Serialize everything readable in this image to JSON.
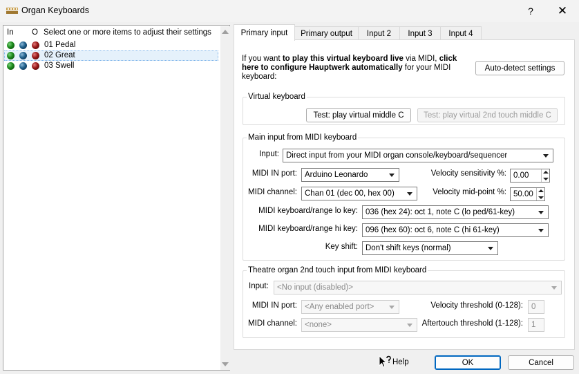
{
  "window": {
    "title": "Organ Keyboards",
    "help_glyph": "?",
    "close_glyph": "✕"
  },
  "list": {
    "headers": {
      "in": "In",
      "o": "O",
      "desc": "Select one or more items to adjust their settings"
    },
    "items": [
      {
        "label": "01 Pedal",
        "selected": false
      },
      {
        "label": "02 Great",
        "selected": true
      },
      {
        "label": "03 Swell",
        "selected": false
      }
    ]
  },
  "tabs": [
    {
      "label": "Primary input",
      "active": true
    },
    {
      "label": "Primary output",
      "active": false
    },
    {
      "label": "Input 2",
      "active": false
    },
    {
      "label": "Input 3",
      "active": false
    },
    {
      "label": "Input 4",
      "active": false
    }
  ],
  "intro": {
    "pre": "If you want ",
    "bold1": "to play this virtual keyboard live",
    "mid": " via MIDI, ",
    "bold2": "click here to configure Hauptwerk automatically",
    "post": " for your MIDI keyboard:"
  },
  "buttons": {
    "auto_detect": "Auto-detect settings",
    "test_middle_c": "Test: play virtual middle C",
    "test_2nd_touch": "Test: play virtual 2nd touch middle C",
    "help": "Help",
    "ok": "OK",
    "cancel": "Cancel"
  },
  "virtual_keyboard": {
    "title": "Virtual keyboard"
  },
  "main_input": {
    "title": "Main input from MIDI keyboard",
    "input_label": "Input:",
    "input_value": "Direct input from your MIDI organ console/keyboard/sequencer",
    "midi_in_port_label": "MIDI IN port:",
    "midi_in_port_value": "Arduino Leonardo",
    "midi_channel_label": "MIDI channel:",
    "midi_channel_value": "Chan 01 (dec 00, hex 00)",
    "velocity_sensitivity_label": "Velocity sensitivity %:",
    "velocity_sensitivity_value": "0.00",
    "velocity_midpoint_label": "Velocity mid-point %:",
    "velocity_midpoint_value": "50.00",
    "lo_key_label": "MIDI keyboard/range lo key:",
    "lo_key_value": "036 (hex 24): oct 1, note C (lo ped/61-key)",
    "hi_key_label": "MIDI keyboard/range hi key:",
    "hi_key_value": "096 (hex 60): oct 6, note C (hi 61-key)",
    "key_shift_label": "Key shift:",
    "key_shift_value": "Don't shift keys (normal)"
  },
  "theatre_input": {
    "title": "Theatre organ 2nd touch input from MIDI keyboard",
    "input_label": "Input:",
    "input_value": "<No input (disabled)>",
    "midi_in_port_label": "MIDI IN port:",
    "midi_in_port_value": "<Any enabled port>",
    "midi_channel_label": "MIDI channel:",
    "midi_channel_value": "<none>",
    "velocity_threshold_label": "Velocity threshold (0-128):",
    "velocity_threshold_value": "0",
    "aftertouch_threshold_label": "Aftertouch threshold (1-128):",
    "aftertouch_threshold_value": "1"
  },
  "colors": {
    "selection_bg": "#e5f1fb",
    "default_button_border": "#0067c0"
  }
}
